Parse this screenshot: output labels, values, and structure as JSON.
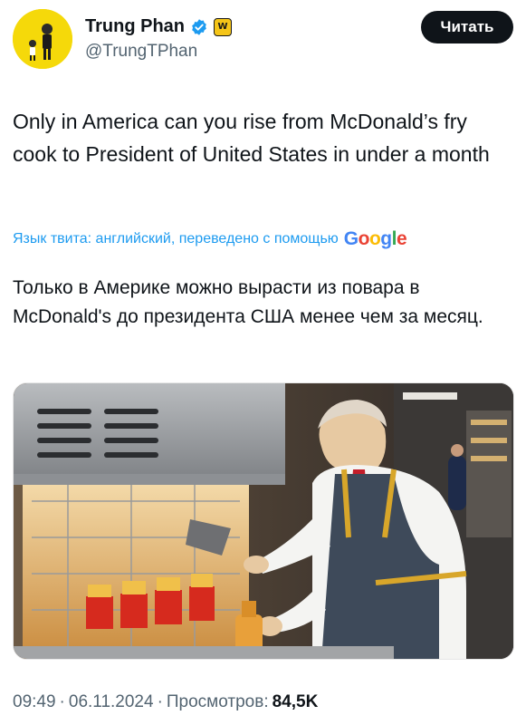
{
  "author": {
    "display_name": "Trung Phan",
    "handle": "@TrungTPhan",
    "affiliate_badge": "W"
  },
  "follow_button": {
    "label": "Читать"
  },
  "tweet": {
    "text": "Only in America can you rise from McDonald’s fry cook to President of United States in under a month"
  },
  "translation": {
    "label": "Язык твита: английский, переведено с помощью",
    "provider": "Google",
    "text": "Только в Америке можно вырасти из повара в McDonald's до президента США менее чем за месяц."
  },
  "meta": {
    "time": "09:49",
    "date": "06.11.2024",
    "views_label": "Просмотров:",
    "views_count": "84,5K"
  },
  "colors": {
    "link": "#1d9bf0",
    "secondary": "#536471",
    "avatar_bg": "#f5d90a",
    "button_bg": "#0f1419"
  }
}
